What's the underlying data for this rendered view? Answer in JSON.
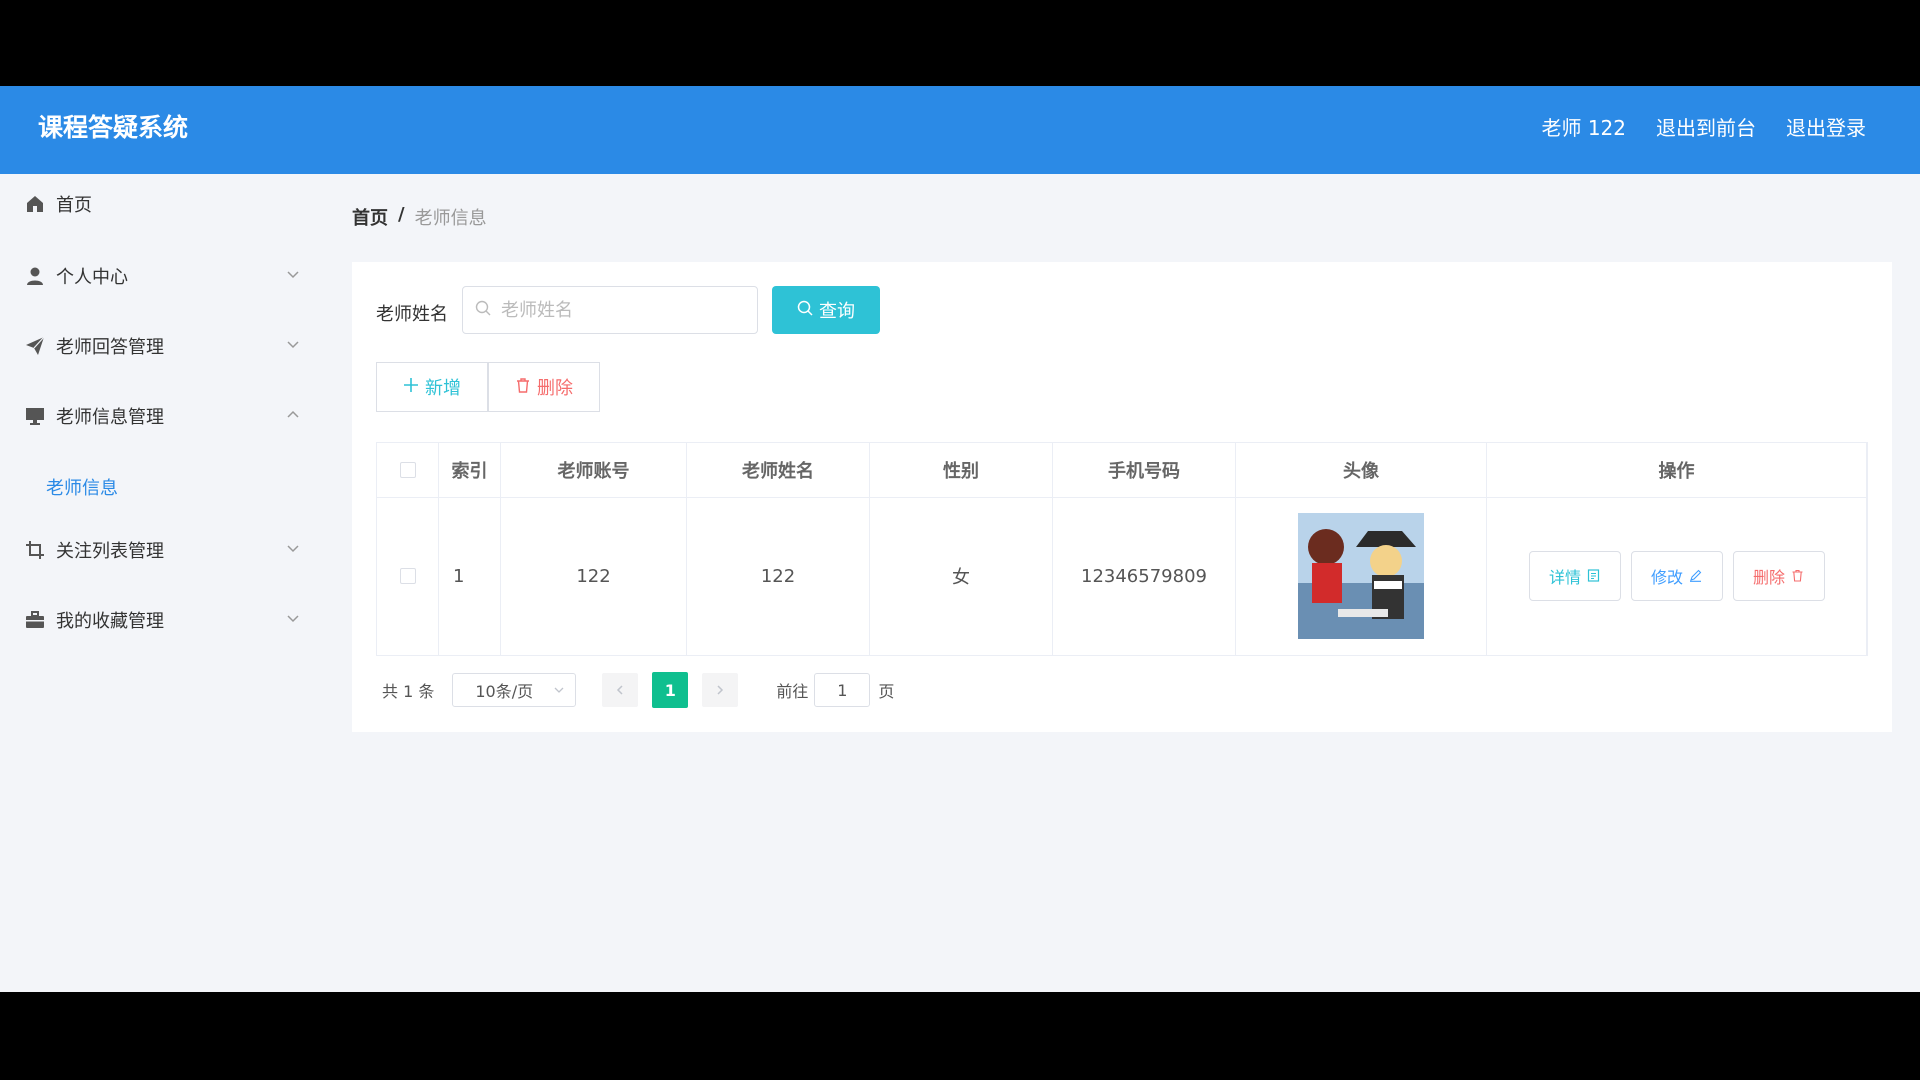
{
  "app": {
    "title": "课程答疑系统"
  },
  "topbar": {
    "user": "老师 122",
    "exit_front": "退出到前台",
    "logout": "退出登录"
  },
  "sidebar": {
    "items": [
      {
        "label": "首页",
        "icon": "home-icon"
      },
      {
        "label": "个人中心",
        "icon": "user-icon",
        "expanded": false
      },
      {
        "label": "老师回答管理",
        "icon": "paper-plane-icon",
        "expanded": false
      },
      {
        "label": "老师信息管理",
        "icon": "monitor-icon",
        "expanded": true
      },
      {
        "label": "关注列表管理",
        "icon": "crop-icon",
        "expanded": false
      },
      {
        "label": "我的收藏管理",
        "icon": "briefcase-icon",
        "expanded": false
      }
    ],
    "submenu": {
      "label": "老师信息"
    }
  },
  "breadcrumb": {
    "home": "首页",
    "separator": "/",
    "current": "老师信息"
  },
  "search": {
    "label": "老师姓名",
    "placeholder": "老师姓名",
    "value": "",
    "button": "查询"
  },
  "actions": {
    "add": "新增",
    "delete": "删除"
  },
  "table": {
    "headers": [
      "索引",
      "老师账号",
      "老师姓名",
      "性别",
      "手机号码",
      "头像",
      "操作"
    ],
    "rows": [
      {
        "index": "1",
        "account": "122",
        "name": "122",
        "gender": "女",
        "phone": "12346579809",
        "avatar": "anime-avatar-image"
      }
    ],
    "row_actions": {
      "detail": "详情",
      "edit": "修改",
      "delete": "删除"
    }
  },
  "pagination": {
    "total": "共 1 条",
    "page_size": "10条/页",
    "current_page": "1",
    "goto_label": "前往",
    "goto_value": "1",
    "page_unit": "页"
  },
  "colors": {
    "header": "#2b8ae6",
    "accent": "#2ec2d6",
    "danger": "#f56c6c",
    "active_page": "#0fbf8f",
    "background": "#f3f5f9"
  }
}
